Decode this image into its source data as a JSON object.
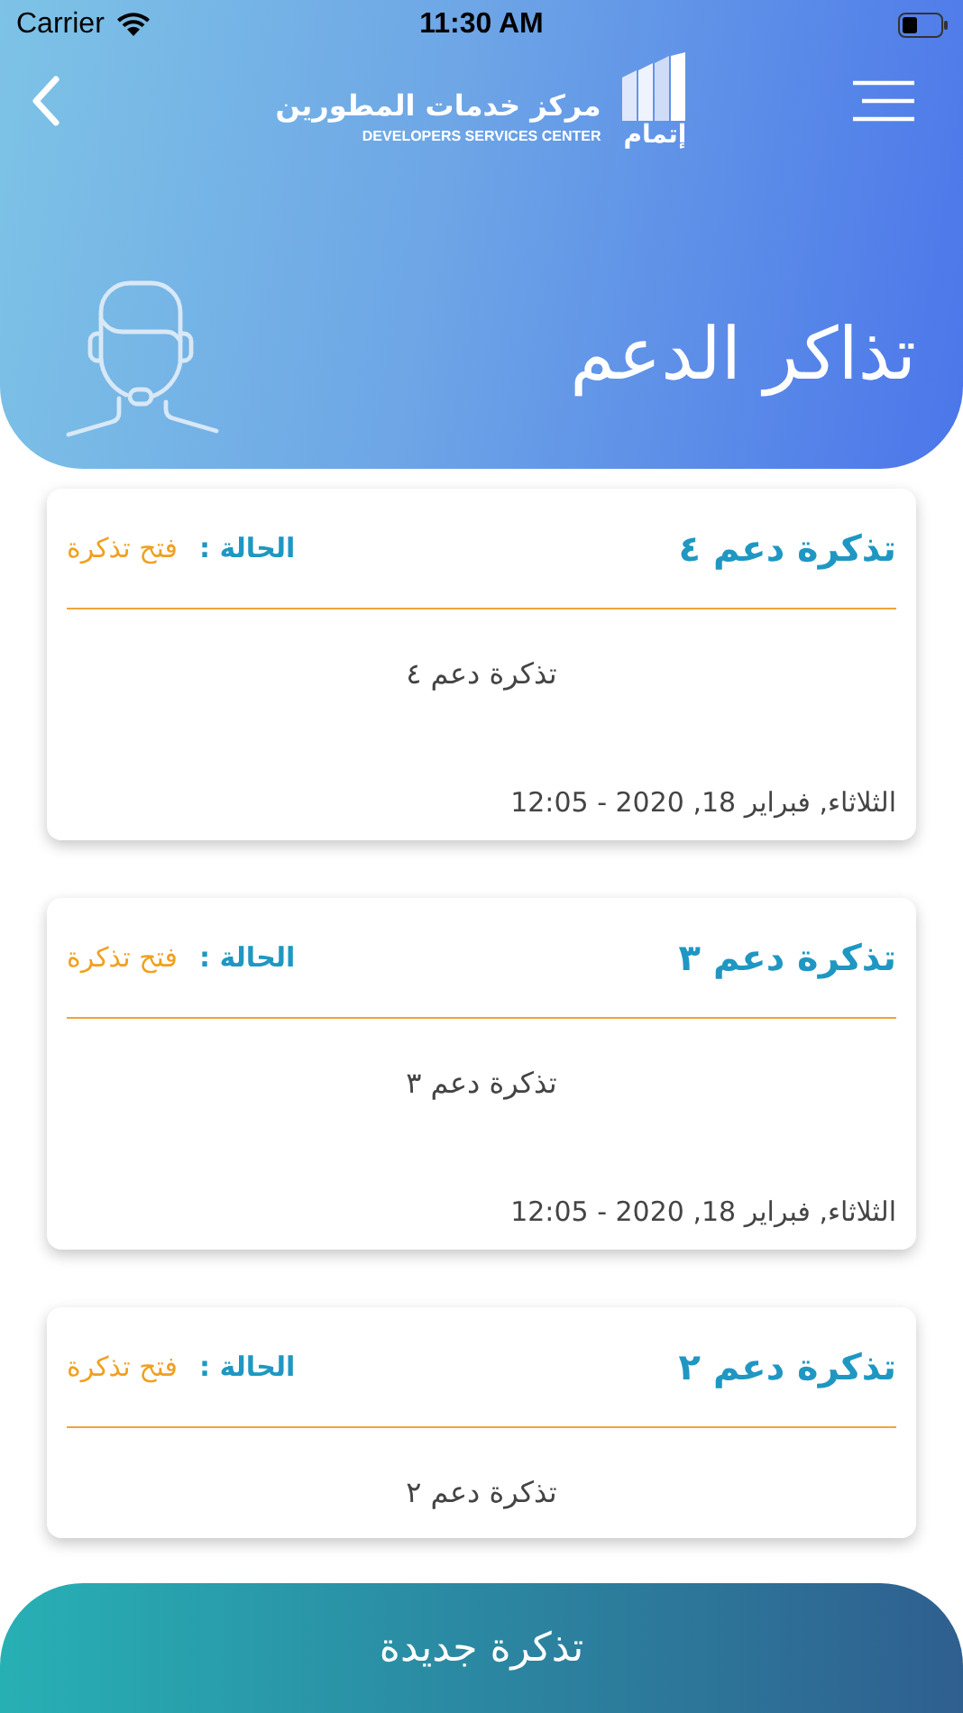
{
  "status_bar": {
    "carrier": "Carrier",
    "time": "11:30 AM"
  },
  "logo": {
    "arabic": "مركز خدمات المطورين",
    "english": "DEVELOPERS SERVICES CENTER",
    "brand": "إتمام"
  },
  "page_title": "تذاكر الدعم",
  "tickets": [
    {
      "title": "تذكرة دعم ٤",
      "status_label": "الحالة :",
      "status": "فتح تذكرة",
      "body": "تذكرة دعم ٤",
      "date": "الثلاثاء, فبراير 18, 2020 - 12:05"
    },
    {
      "title": "تذكرة دعم ٣",
      "status_label": "الحالة :",
      "status": "فتح تذكرة",
      "body": "تذكرة دعم ٣",
      "date": "الثلاثاء, فبراير 18, 2020 - 12:05"
    },
    {
      "title": "تذكرة دعم ٢",
      "status_label": "الحالة :",
      "status": "فتح تذكرة",
      "body": "تذكرة دعم ٢"
    }
  ],
  "new_ticket_button": "تذكرة جديدة"
}
